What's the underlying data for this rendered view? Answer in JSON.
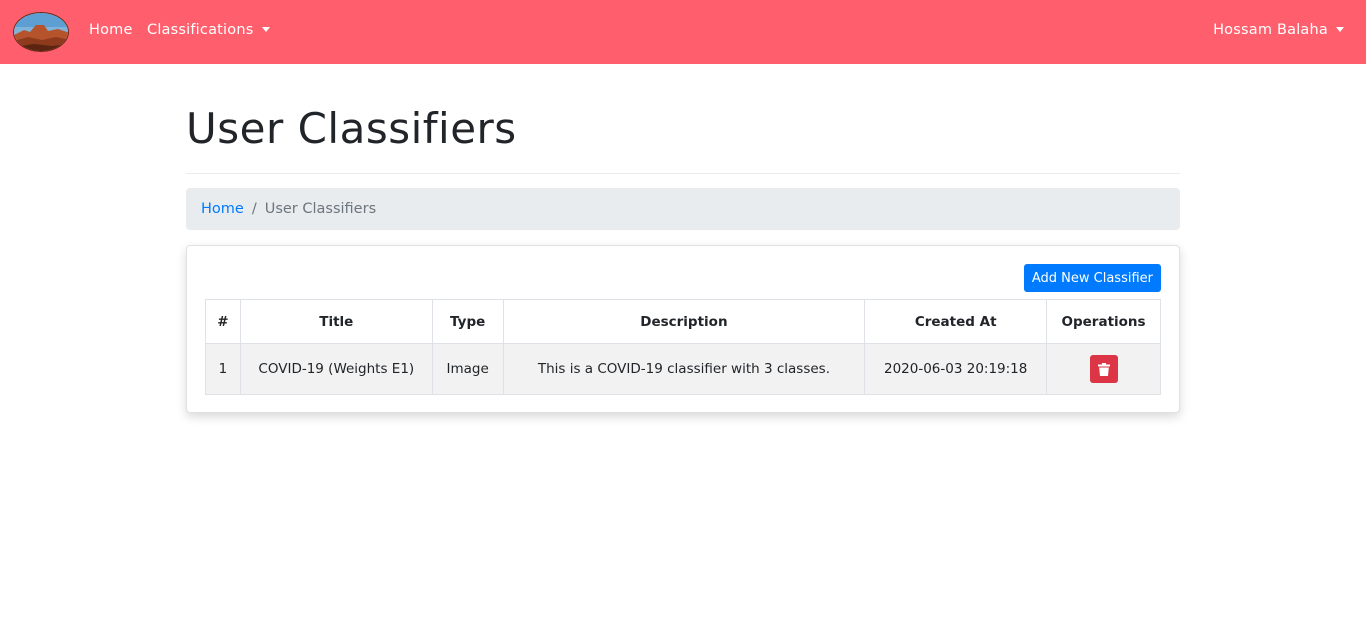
{
  "navbar": {
    "home_label": "Home",
    "classifications_label": "Classifications",
    "user_label": "Hossam Balaha",
    "brand_color": "#ff5f6d"
  },
  "page": {
    "title": "User Classifiers"
  },
  "breadcrumb": {
    "items": [
      "Home",
      "User Classifiers"
    ],
    "separator": "/"
  },
  "card": {
    "add_button_label": "Add New Classifier",
    "table": {
      "headers": [
        "#",
        "Title",
        "Type",
        "Description",
        "Created At",
        "Operations"
      ],
      "rows": [
        {
          "num": "1",
          "title": "COVID-19 (Weights E1)",
          "type": "Image",
          "description": "This is a COVID-19 classifier with 3 classes.",
          "created_at": "2020-06-03 20:19:18",
          "operation_icon": "trash-icon"
        }
      ]
    }
  },
  "colors": {
    "primary": "#007bff",
    "danger": "#dc3545",
    "navbar": "#ff5f6d"
  }
}
